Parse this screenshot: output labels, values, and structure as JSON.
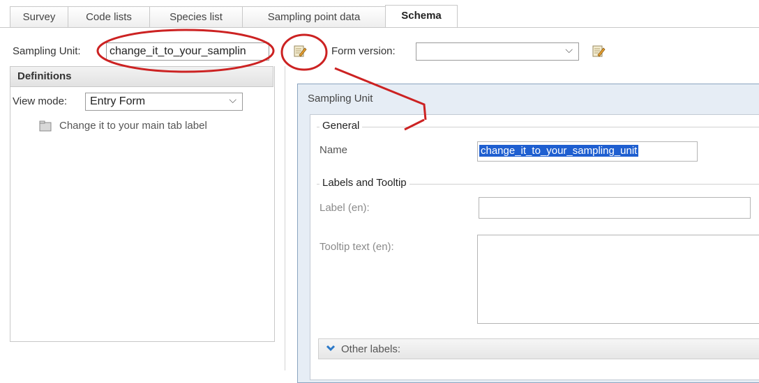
{
  "tabs": [
    {
      "label": "Survey"
    },
    {
      "label": "Code lists"
    },
    {
      "label": "Species list"
    },
    {
      "label": "Sampling point data"
    },
    {
      "label": "Schema"
    }
  ],
  "toolbar": {
    "sampling_unit_label": "Sampling Unit:",
    "sampling_unit_value": "change_it_to_your_samplin",
    "form_version_label": "Form version:",
    "form_version_value": ""
  },
  "definitions": {
    "header": "Definitions",
    "view_mode_label": "View mode:",
    "view_mode_value": "Entry Form",
    "tree_items": [
      {
        "label": "Change it to your main tab label",
        "icon": "tab-icon"
      }
    ]
  },
  "dialog": {
    "title": "Sampling Unit",
    "general_legend": "General",
    "name_label": "Name",
    "name_value": "change_it_to_your_sampling_unit",
    "labels_legend": "Labels and Tooltip",
    "label_en_label": "Label (en):",
    "label_en_value": "",
    "tooltip_label": "Tooltip text (en):",
    "tooltip_value": "",
    "other_labels": "Other labels:"
  },
  "colors": {
    "annotation_red": "#cc2222",
    "selection_blue": "#1f5fd0",
    "dialog_border": "#8aa4c0"
  }
}
